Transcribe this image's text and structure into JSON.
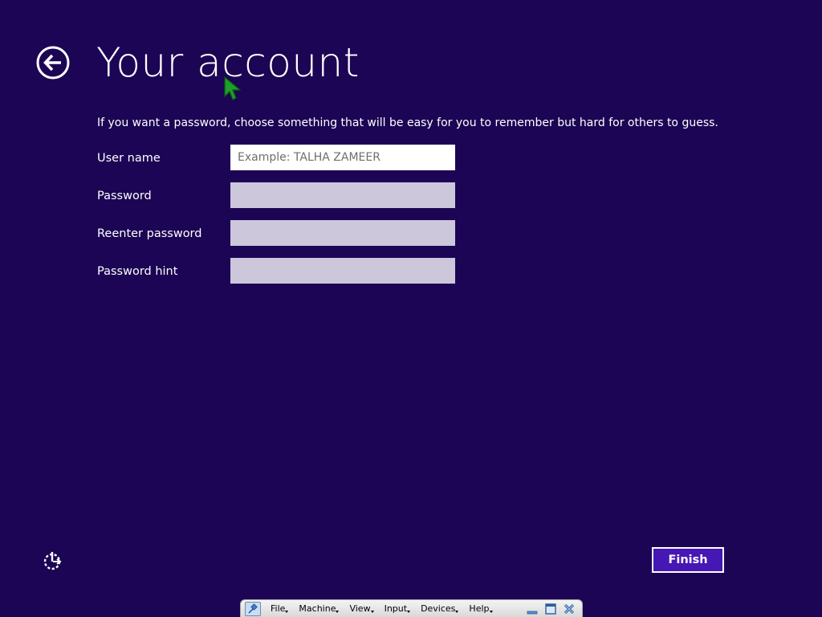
{
  "page": {
    "title": "Your account",
    "instructions": "If you want a password, choose something that will be easy for you to remember but hard for others to guess."
  },
  "form": {
    "fields": [
      {
        "label": "User name",
        "value": "",
        "placeholder": "Example: TALHA ZAMEER"
      },
      {
        "label": "Password",
        "value": "",
        "placeholder": ""
      },
      {
        "label": "Reenter password",
        "value": "",
        "placeholder": ""
      },
      {
        "label": "Password hint",
        "value": "",
        "placeholder": ""
      }
    ]
  },
  "buttons": {
    "finish": "Finish",
    "back_icon": "back-arrow-icon",
    "accessibility_icon": "ease-of-access-icon"
  },
  "vm_toolbar": {
    "menus": [
      "File",
      "Machine",
      "View",
      "Input",
      "Devices",
      "Help"
    ],
    "icons": [
      "pin-icon",
      "minimize-icon",
      "restore-icon",
      "close-icon"
    ]
  },
  "colors": {
    "background": "#1c0554",
    "accent_button": "#4617b4",
    "input_inactive": "#cdc7dc",
    "input_active": "#ffffff"
  }
}
